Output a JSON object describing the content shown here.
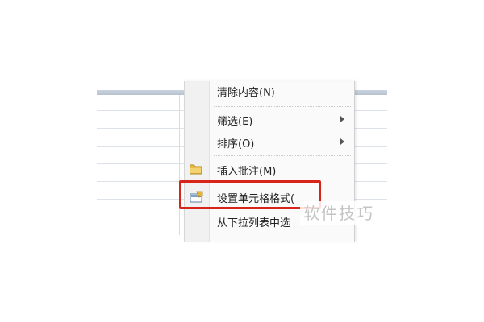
{
  "context_menu": {
    "items": [
      {
        "label": "清除内容(N)",
        "icon": "",
        "has_submenu": false
      },
      {
        "label": "筛选(E)",
        "icon": "",
        "has_submenu": true
      },
      {
        "label": "排序(O)",
        "icon": "",
        "has_submenu": true
      },
      {
        "label": "插入批注(M)",
        "icon": "folder-icon",
        "has_submenu": false
      },
      {
        "label": "设置单元格格式(",
        "icon": "format-cells-icon",
        "has_submenu": false
      },
      {
        "label": "从下拉列表中选",
        "icon": "",
        "has_submenu": false
      }
    ]
  },
  "highlight": {
    "target": "设置单元格格式(",
    "color": "#d9241c"
  },
  "watermark": {
    "text": "软件技巧"
  }
}
